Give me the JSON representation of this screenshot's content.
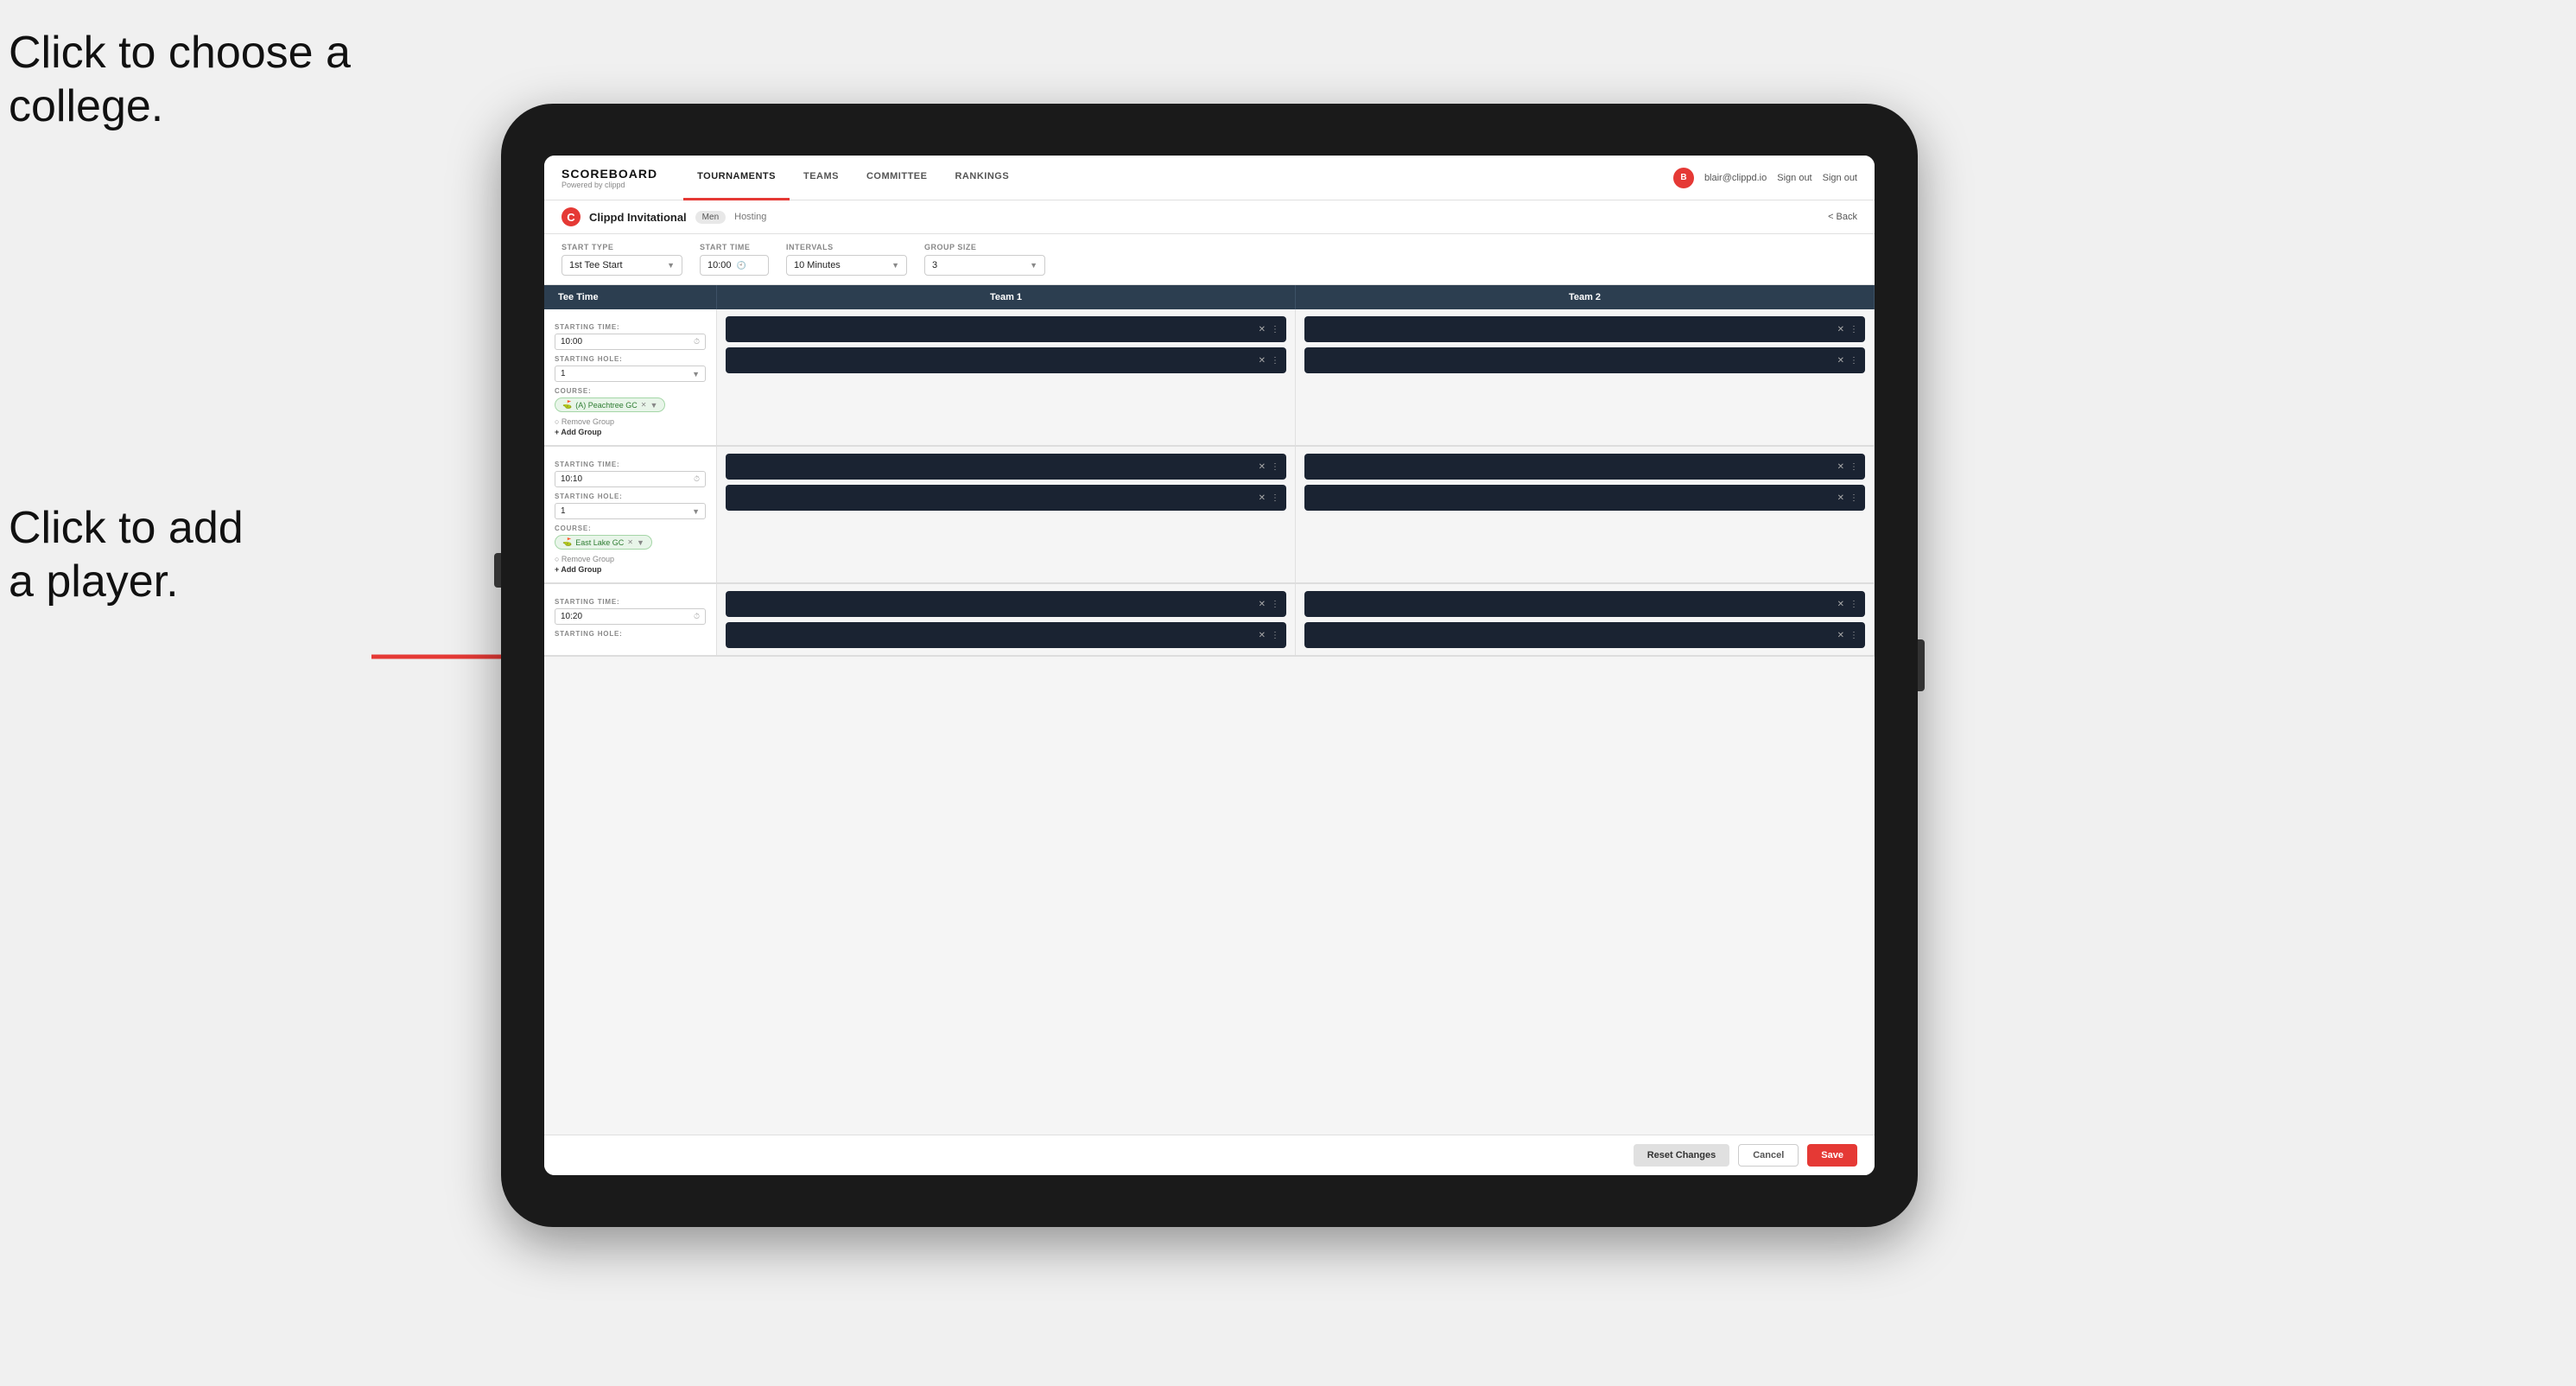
{
  "annotations": {
    "text1_line1": "Click to choose a",
    "text1_line2": "college.",
    "text2_line1": "Click to add",
    "text2_line2": "a player."
  },
  "nav": {
    "brand": "SCOREBOARD",
    "brand_sub": "Powered by clippd",
    "links": [
      "TOURNAMENTS",
      "TEAMS",
      "COMMITTEE",
      "RANKINGS"
    ],
    "active_link": "TOURNAMENTS",
    "user_email": "blair@clippd.io",
    "sign_out": "Sign out"
  },
  "sub_header": {
    "logo": "C",
    "title": "Clippd Invitational",
    "badge": "Men",
    "hosting": "Hosting",
    "back": "< Back"
  },
  "form": {
    "start_type_label": "Start Type",
    "start_type_value": "1st Tee Start",
    "start_time_label": "Start Time",
    "start_time_value": "10:00",
    "intervals_label": "Intervals",
    "intervals_value": "10 Minutes",
    "group_size_label": "Group Size",
    "group_size_value": "3"
  },
  "table": {
    "col_tee_time": "Tee Time",
    "col_team1": "Team 1",
    "col_team2": "Team 2"
  },
  "groups": [
    {
      "starting_time": "10:00",
      "starting_hole": "1",
      "course": "(A) Peachtree GC",
      "course_color": "green",
      "players_team1": 2,
      "players_team2": 2
    },
    {
      "starting_time": "10:10",
      "starting_hole": "1",
      "course": "East Lake GC",
      "course_color": "green",
      "players_team1": 2,
      "players_team2": 2
    },
    {
      "starting_time": "10:20",
      "starting_hole": "",
      "course": "",
      "players_team1": 2,
      "players_team2": 2
    }
  ],
  "footer": {
    "reset_label": "Reset Changes",
    "cancel_label": "Cancel",
    "save_label": "Save"
  }
}
